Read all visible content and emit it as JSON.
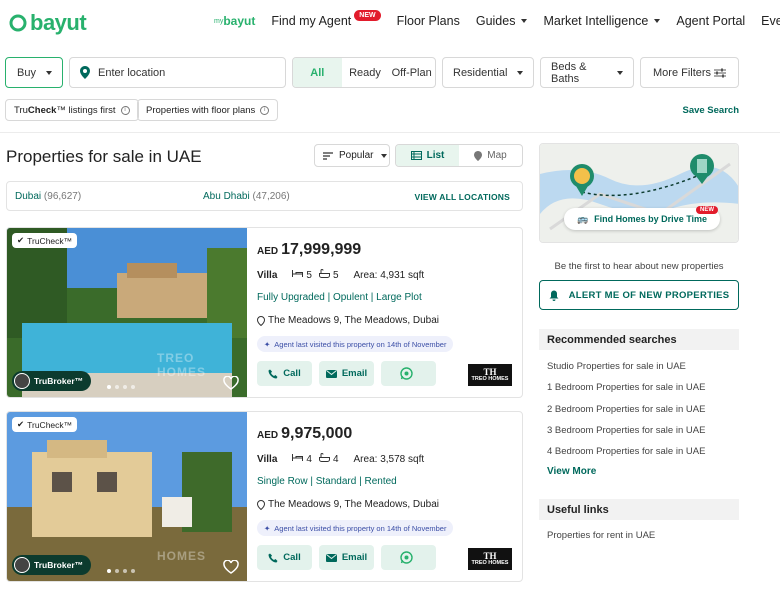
{
  "header": {
    "logo": "bayut",
    "nav": {
      "mybayut_prefix": "my",
      "mybayut": "bayut",
      "find_agent": "Find my Agent",
      "new_badge": "NEW",
      "floor_plans": "Floor Plans",
      "guides": "Guides",
      "market": "Market Intelligence",
      "agent_portal": "Agent Portal",
      "events": "Events"
    }
  },
  "search": {
    "purpose": "Buy",
    "location_placeholder": "Enter location",
    "completion": [
      "All",
      "Ready",
      "Off-Plan"
    ],
    "category": "Residential",
    "beds_baths": "Beds & Baths",
    "more_filters": "More Filters"
  },
  "chips": {
    "truecheck_prefix": "Tru",
    "truecheck_bold": "Check",
    "truecheck_suffix": "™ listings first",
    "floor_plans": "Properties with floor plans",
    "save_search": "Save Search"
  },
  "main": {
    "title": "Properties for sale in UAE",
    "sort": "Popular",
    "view_list": "List",
    "view_map": "Map",
    "locations": [
      {
        "name": "Dubai",
        "count": "(96,627)"
      },
      {
        "name": "Abu Dhabi",
        "count": "(47,206)"
      }
    ],
    "view_all_locations": "VIEW ALL LOCATIONS"
  },
  "listings": [
    {
      "truecheck": "TruCheck™",
      "trubroker": "TruBroker™",
      "watermark": "TREO HOMES",
      "currency": "AED",
      "price": "17,999,999",
      "type": "Villa",
      "beds": "5",
      "baths": "5",
      "area_label": "Area:",
      "area": "4,931 sqft",
      "headline": "Fully Upgraded | Opulent | Large Plot",
      "address": "The Meadows 9, The Meadows, Dubai",
      "visited": "Agent last visited this property on 14th of November",
      "call": "Call",
      "email": "Email",
      "agency_mark": "TH",
      "agency_name": "TREO HOMES"
    },
    {
      "truecheck": "TruCheck™",
      "trubroker": "TruBroker™",
      "watermark": "HOMES",
      "currency": "AED",
      "price": "9,975,000",
      "type": "Villa",
      "beds": "4",
      "baths": "4",
      "area_label": "Area:",
      "area": "3,578 sqft",
      "headline": "Single Row | Standard | Rented",
      "address": "The Meadows 9, The Meadows, Dubai",
      "visited": "Agent last visited this property on 14th of November",
      "call": "Call",
      "email": "Email",
      "agency_mark": "TH",
      "agency_name": "TREO HOMES"
    }
  ],
  "sidebar": {
    "drive_time": "Find Homes by Drive Time",
    "drive_badge": "NEW",
    "be_first": "Be the first to hear about new properties",
    "alert_button": "ALERT ME OF NEW PROPERTIES",
    "recommended_title": "Recommended searches",
    "recommended": [
      "Studio Properties for sale in UAE",
      "1 Bedroom Properties for sale in UAE",
      "2 Bedroom Properties for sale in UAE",
      "3 Bedroom Properties for sale in UAE",
      "4 Bedroom Properties for sale in UAE"
    ],
    "view_more": "View More",
    "useful_title": "Useful links",
    "useful": [
      "Properties for rent in UAE"
    ]
  },
  "colors": {
    "brand_green": "#28b16d",
    "link_teal": "#00695c",
    "new_red": "#e21c2c"
  }
}
